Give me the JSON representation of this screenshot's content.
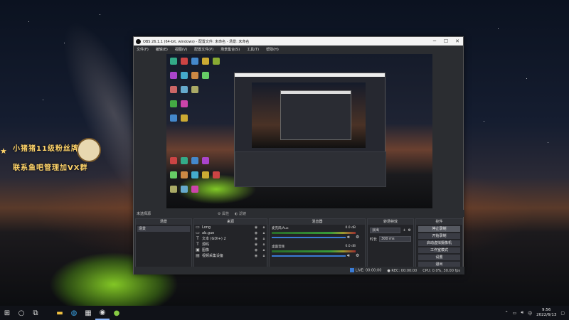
{
  "desktop": {
    "watermark_line1": "小猪猪11级粉丝牌",
    "watermark_line2": "联系鱼吧管理加VX群"
  },
  "obs": {
    "title": "OBS 26.1.1 (64-bit, windows) - 配置文件: 未命名 - 场景: 未命名",
    "menu": [
      "文件(F)",
      "编辑(E)",
      "视图(V)",
      "配置文件(P)",
      "场景集合(S)",
      "工具(T)",
      "帮助(H)"
    ],
    "scene_bar": {
      "label": "未选择源",
      "props_label": "属性",
      "filters_label": "滤镜"
    },
    "docks": {
      "scenes": {
        "title": "场景",
        "items": [
          "场景"
        ]
      },
      "sources": {
        "title": "来源",
        "items": [
          {
            "icon": "display-capture-icon",
            "glyph": "▭",
            "name": "Long"
          },
          {
            "icon": "display-capture-icon",
            "glyph": "▭",
            "name": "ab.gue"
          },
          {
            "icon": "text-icon",
            "glyph": "T",
            "name": "文本 (GDI+) 2"
          },
          {
            "icon": "text-icon",
            "glyph": "T",
            "name": "源码"
          },
          {
            "icon": "image-icon",
            "glyph": "▣",
            "name": "图像"
          },
          {
            "icon": "video-capture-icon",
            "glyph": "▤",
            "name": "视频采集设备"
          }
        ]
      },
      "mixer": {
        "title": "混音器",
        "channels": [
          {
            "name": "麦克风/Aux",
            "db": "0.0 dB"
          },
          {
            "name": "桌面音频",
            "db": "0.0 dB"
          }
        ]
      },
      "transitions": {
        "title": "转场特效",
        "type": "淡出",
        "duration_label": "时长",
        "duration_value": "300 ms"
      },
      "controls": {
        "title": "控件",
        "buttons": [
          "停止录制",
          "开始录制",
          "启动虚拟摄像机",
          "工作室模式",
          "设置",
          "退出"
        ]
      }
    },
    "status": {
      "live": "LIVE: 00:00:00",
      "rec": "REC: 00:00:00",
      "cpu": "CPU: 0.0%, 30.00 fps"
    }
  },
  "taskbar": {
    "lang": "中",
    "time": "9:56",
    "date": "2022/6/13"
  },
  "colors": {
    "obs_bg": "#2b2d31",
    "accent_blue": "#3a7bd5",
    "watermark": "#ffd46a",
    "tent_green": "#96e628"
  }
}
